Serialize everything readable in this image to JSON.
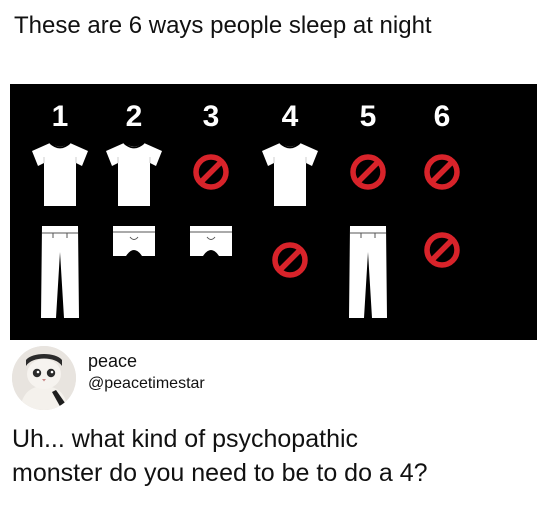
{
  "post": {
    "title": "These are 6 ways people sleep at night",
    "author": {
      "name": "peace",
      "handle": "@peacetimestar"
    },
    "text_lines": [
      "Uh... what kind of psychopathic",
      "monster do you need to be to do a 4?"
    ]
  },
  "meme": {
    "columns": [
      {
        "number": "1",
        "top": "t-shirt-icon",
        "bottom": "pants-icon"
      },
      {
        "number": "2",
        "top": "t-shirt-icon",
        "bottom": "underwear-icon"
      },
      {
        "number": "3",
        "top": "no-symbol-icon",
        "bottom": "underwear-icon"
      },
      {
        "number": "4",
        "top": "t-shirt-icon",
        "bottom": "no-symbol-icon"
      },
      {
        "number": "5",
        "top": "no-symbol-icon",
        "bottom": "pants-icon"
      },
      {
        "number": "6",
        "top": "no-symbol-icon",
        "bottom": "no-symbol-icon"
      }
    ],
    "colors": {
      "background": "#000000",
      "numbers": "#ffffff",
      "clothing": "#ffffff",
      "no_symbol": "#d8232a"
    }
  }
}
